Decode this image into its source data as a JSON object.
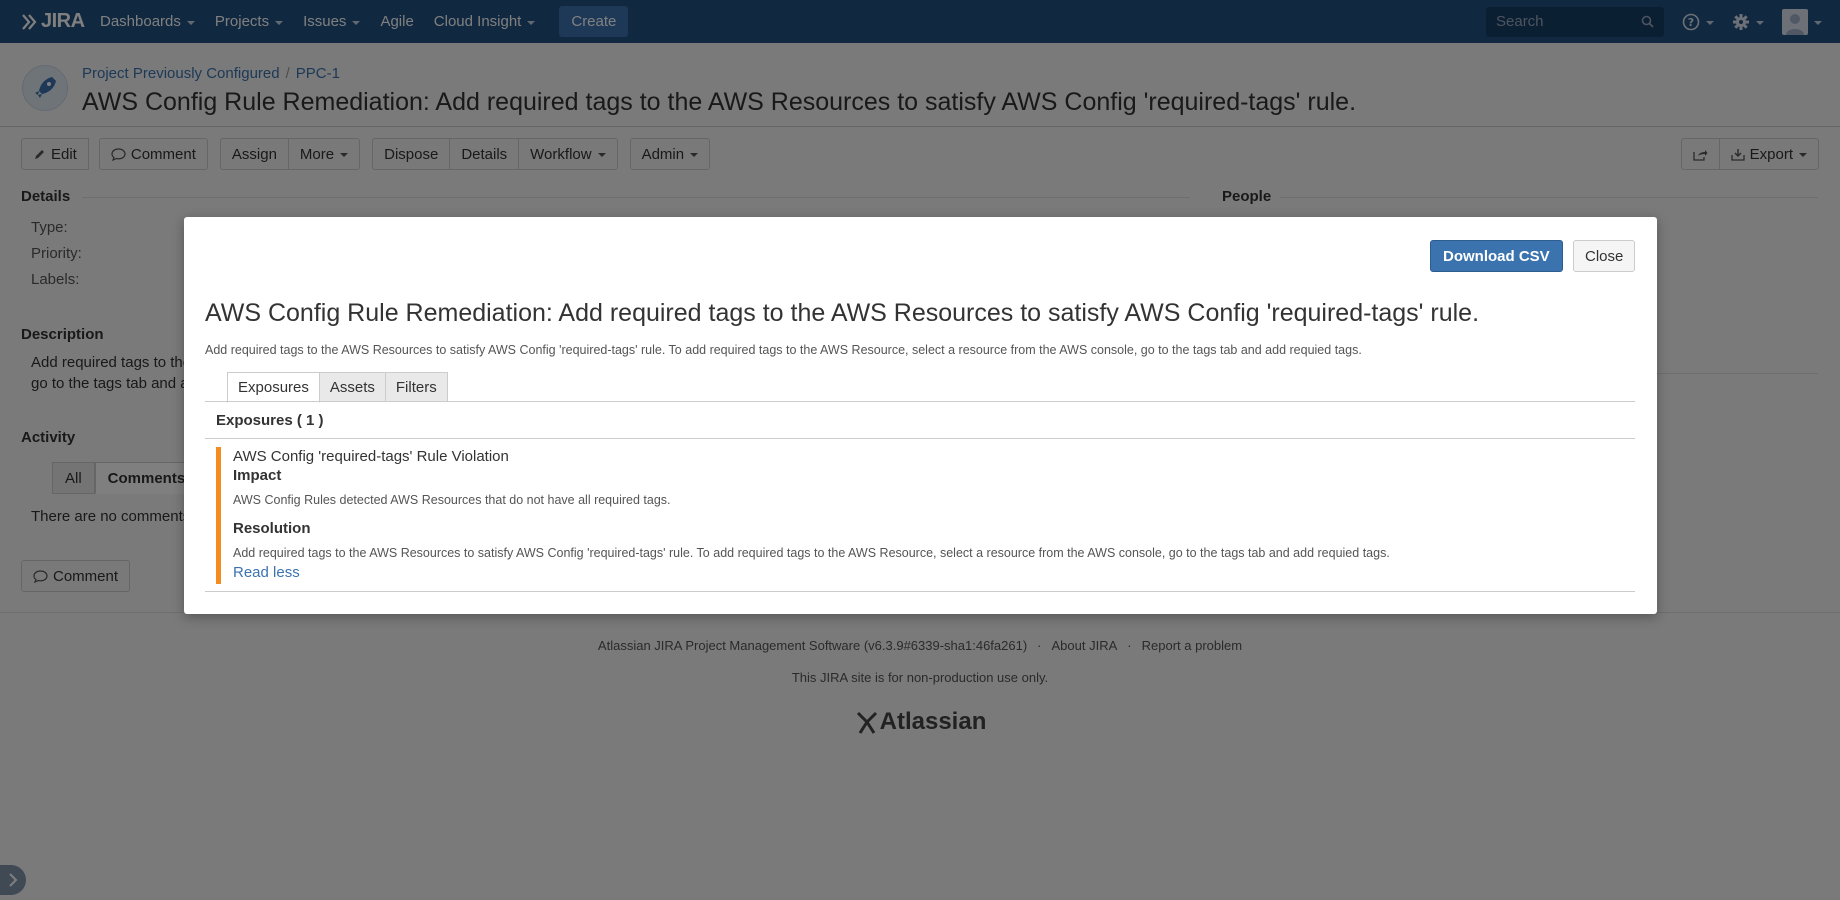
{
  "nav": {
    "logo": "JIRA",
    "items": [
      {
        "label": "Dashboards",
        "dropdown": true
      },
      {
        "label": "Projects",
        "dropdown": true
      },
      {
        "label": "Issues",
        "dropdown": true
      },
      {
        "label": "Agile",
        "dropdown": false
      },
      {
        "label": "Cloud Insight",
        "dropdown": true
      }
    ],
    "create_label": "Create",
    "search_placeholder": "Search"
  },
  "header": {
    "project_name": "Project Previously Configured",
    "separator": "/",
    "issue_key": "PPC-1",
    "title": "AWS Config Rule Remediation: Add required tags to the AWS Resources to satisfy AWS Config 'required-tags' rule."
  },
  "toolbar": {
    "edit": "Edit",
    "comment": "Comment",
    "assign": "Assign",
    "more": "More",
    "dispose": "Dispose",
    "details": "Details",
    "workflow": "Workflow",
    "admin": "Admin",
    "export": "Export"
  },
  "details": {
    "heading": "Details",
    "people_heading": "People",
    "type_label": "Type:",
    "priority_label": "Priority:",
    "labels_label": "Labels:"
  },
  "description": {
    "heading": "Description",
    "line1": "Add required tags to the",
    "line2": "go to the tags tab and a"
  },
  "activity": {
    "heading": "Activity",
    "tabs": [
      "All",
      "Comments"
    ],
    "no_comments": "There are no comments",
    "comment_button": "Comment"
  },
  "footer": {
    "software": "Atlassian JIRA Project Management Software (v6.3.9#6339-sha1:46fa261)",
    "dot": "·",
    "about": "About JIRA",
    "report": "Report a problem",
    "note": "This JIRA site is for non-production use only.",
    "logo": "Atlassian"
  },
  "modal": {
    "download_label": "Download CSV",
    "close_label": "Close",
    "title": "AWS Config Rule Remediation: Add required tags to the AWS Resources to satisfy AWS Config 'required-tags' rule.",
    "description": "Add required tags to the AWS Resources to satisfy AWS Config 'required-tags' rule. To add required tags to the AWS Resource, select a resource from the AWS console, go to the tags tab and add requied tags.",
    "tabs": [
      "Exposures",
      "Assets",
      "Filters"
    ],
    "exposures_count": "Exposures ( 1 )",
    "exposure": {
      "name": "AWS Config 'required-tags' Rule Violation",
      "impact_heading": "Impact",
      "impact_text": "AWS Config Rules detected AWS Resources that do not have all required tags.",
      "resolution_heading": "Resolution",
      "resolution_text": "Add required tags to the AWS Resources to satisfy AWS Config 'required-tags' rule. To add required tags to the AWS Resource, select a resource from the AWS console, go to the tags tab and add requied tags.",
      "read_less": "Read less"
    }
  },
  "colors": {
    "nav_bg": "#205081",
    "primary": "#3b73af",
    "exposure_accent": "#f38c21"
  }
}
